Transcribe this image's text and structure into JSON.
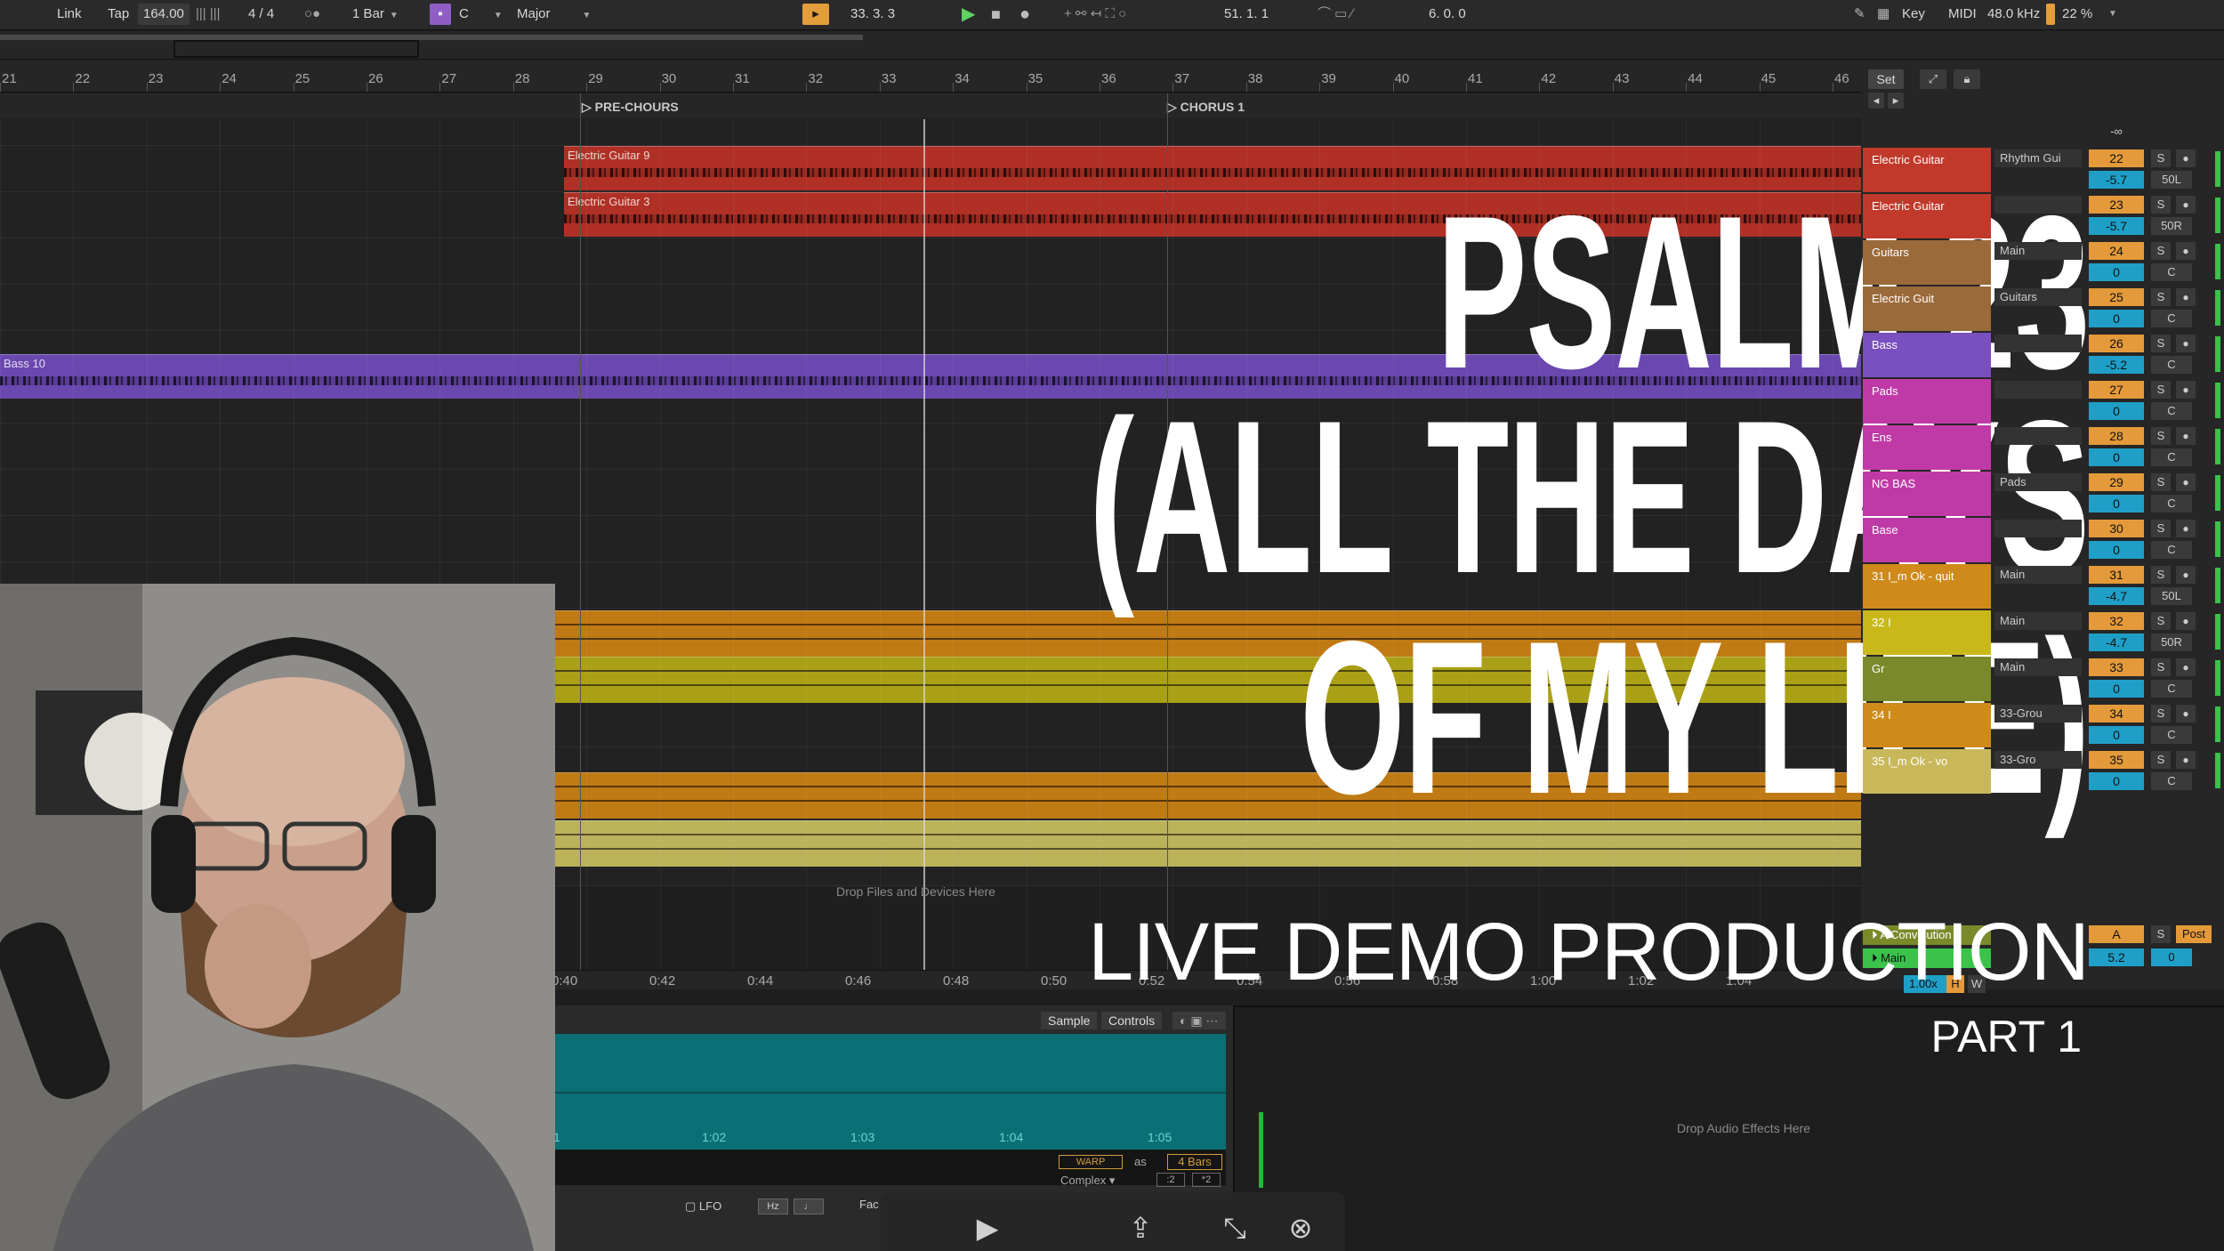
{
  "toolbar": {
    "link": "Link",
    "tap": "Tap",
    "tempo": "164.00",
    "time_signature": "4 / 4",
    "quantize": "1 Bar",
    "key_root": "C",
    "scale": "Major",
    "position": "33.  3.  3",
    "loop_start": "51.  1.  1",
    "loop_length": "6.  0.  0",
    "key_label": "Key",
    "midi_label": "MIDI",
    "sample_rate": "48.0 kHz",
    "cpu": "22 %"
  },
  "ruler": {
    "bars": [
      "21",
      "22",
      "23",
      "24",
      "25",
      "26",
      "27",
      "28",
      "29",
      "30",
      "31",
      "32",
      "33",
      "34",
      "35",
      "36",
      "37",
      "38",
      "39",
      "40",
      "41",
      "42",
      "43",
      "44",
      "45",
      "46"
    ]
  },
  "locators": [
    {
      "label": "PRE-CHOURS"
    },
    {
      "label": "CHORUS 1"
    }
  ],
  "clips": {
    "electric_guitar_9": "Electric Guitar 9",
    "electric_guitar_3": "Electric Guitar 3",
    "bass_10": "Bass 10"
  },
  "arrangement": {
    "drop_hint": "Drop Files and Devices Here"
  },
  "time_ruler": [
    "0:40",
    "0:42",
    "0:44",
    "0:46",
    "0:48",
    "0:50",
    "0:52",
    "0:54",
    "0:56",
    "0:58",
    "1:00",
    "1:02",
    "1:04"
  ],
  "tracks": [
    {
      "name": "Electric Guitar",
      "routing": "Rhythm Gui",
      "number": "22",
      "volume": "-5.7",
      "pan": "50L",
      "color": "#c0392b"
    },
    {
      "name": "Electric Guitar",
      "routing": "",
      "number": "23",
      "volume": "-5.7",
      "pan": "50R",
      "color": "#c0392b"
    },
    {
      "name": "Guitars",
      "routing": "Main",
      "number": "24",
      "volume": "0",
      "pan": "C",
      "color": "#9a6a3a"
    },
    {
      "name": "Electric Guit",
      "routing": "Guitars",
      "number": "25",
      "volume": "0",
      "pan": "C",
      "color": "#9a6a3a"
    },
    {
      "name": "Bass",
      "routing": "",
      "number": "26",
      "volume": "-5.2",
      "pan": "C",
      "color": "#7a4fc0"
    },
    {
      "name": "Pads",
      "routing": "",
      "number": "27",
      "volume": "0",
      "pan": "C",
      "color": "#c03aa7"
    },
    {
      "name": "Ens",
      "routing": "",
      "number": "28",
      "volume": "0",
      "pan": "C",
      "color": "#c03aa7"
    },
    {
      "name": "NG BAS",
      "routing": "Pads",
      "number": "29",
      "volume": "0",
      "pan": "C",
      "color": "#c03aa7"
    },
    {
      "name": "Base",
      "routing": "",
      "number": "30",
      "volume": "0",
      "pan": "C",
      "color": "#c03aa7"
    },
    {
      "name": "31 I_m Ok - quit",
      "routing": "Main",
      "number": "31",
      "volume": "-4.7",
      "pan": "50L",
      "color": "#d08a1a"
    },
    {
      "name": "32 I",
      "routing": "Main",
      "number": "32",
      "volume": "-4.7",
      "pan": "50R",
      "color": "#c8b81a"
    },
    {
      "name": "Gr",
      "routing": "Main",
      "number": "33",
      "volume": "0",
      "pan": "C",
      "color": "#7a8a2a"
    },
    {
      "name": "34 I",
      "routing": "33-Grou",
      "number": "34",
      "volume": "0",
      "pan": "C",
      "color": "#d08a1a"
    },
    {
      "name": "35 I_m Ok - vo",
      "routing": "33-Gro",
      "number": "35",
      "volume": "0",
      "pan": "C",
      "color": "#c8b85a"
    }
  ],
  "returns": {
    "reverb_name": "A Convolution",
    "main_name": "Main",
    "return_label": "A",
    "post": "Post",
    "main_volume": "5.2",
    "main_pan": "0",
    "neg_inf": "-∞",
    "speed": "1.00x"
  },
  "clip_view": {
    "tab_sample": "Sample",
    "tab_controls": "Controls",
    "ruler": [
      "1",
      "1:02",
      "1:03",
      "1:04",
      "1:05"
    ],
    "warp": "WARP",
    "as": "as",
    "bars": "4 Bars",
    "mode": "Complex",
    "div": ":2",
    "mul": "*2",
    "lfo": "LFO",
    "hz": "Hz",
    "fac": "Fac"
  },
  "device_view": {
    "drop_hint": "Drop Audio Effects Here"
  },
  "overlay": {
    "title_line1": "PSALM 23",
    "title_line2": "(ALL THE DAYS",
    "title_line3": "OF MY LIFE)",
    "subtitle": "LIVE DEMO PRODUCTION",
    "part": "PART 1"
  },
  "icons": [
    "play-icon",
    "stop-icon",
    "record-icon",
    "share-icon",
    "collapse-icon",
    "close-icon",
    "pencil-icon",
    "metronome-icon"
  ]
}
